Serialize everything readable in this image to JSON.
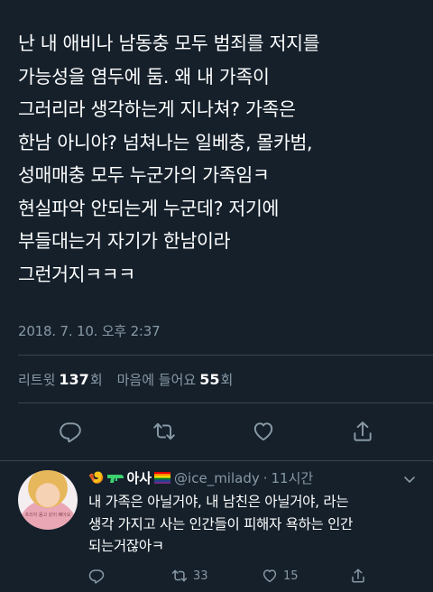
{
  "tweet": {
    "lines": [
      "난 내 애비나 남동충 모두 범죄를 저지를",
      "가능성을 염두에 둠. 왜 내 가족이",
      "그러리라 생각하는게 지나쳐? 가족은",
      "한남 아니야? 넘쳐나는 일베충, 몰카범,",
      "성매매충 모두 누군가의 가족임ㅋ",
      "현실파악 안되는게 누군데? 저기에",
      "부들대는거 자기가 한남이라",
      "그런거지ㅋㅋㅋ"
    ],
    "timestamp": "2018. 7. 10. 오후 2:37"
  },
  "stats": {
    "retweets_label": "리트윗",
    "retweets_count": "137",
    "retweets_suffix": "회",
    "likes_label": "마음에 들어요",
    "likes_count": "55",
    "likes_suffix": "회"
  },
  "actions": {
    "icons": [
      "reply-icon",
      "retweet-icon",
      "like-icon",
      "share-icon"
    ]
  },
  "reply": {
    "emoji_prefix": "🍤",
    "display_name": "아사",
    "handle": "@ice_milady",
    "separator": "·",
    "time": "11시간",
    "avatar_caption": "프리지 몸고 같이 빼아요",
    "lines": [
      "내 가족은 아닐거야, 내 남친은 아닐거야, 라는",
      "생각 가지고 사는 인간들이 피해자 욕하는 인간",
      "되는거잖아ㅋ"
    ],
    "retweet_count": "33",
    "like_count": "15"
  },
  "colors": {
    "background": "#15202b",
    "secondary_text": "#8899a6",
    "divider": "#38444d",
    "gun_green": "#3bd16f"
  }
}
